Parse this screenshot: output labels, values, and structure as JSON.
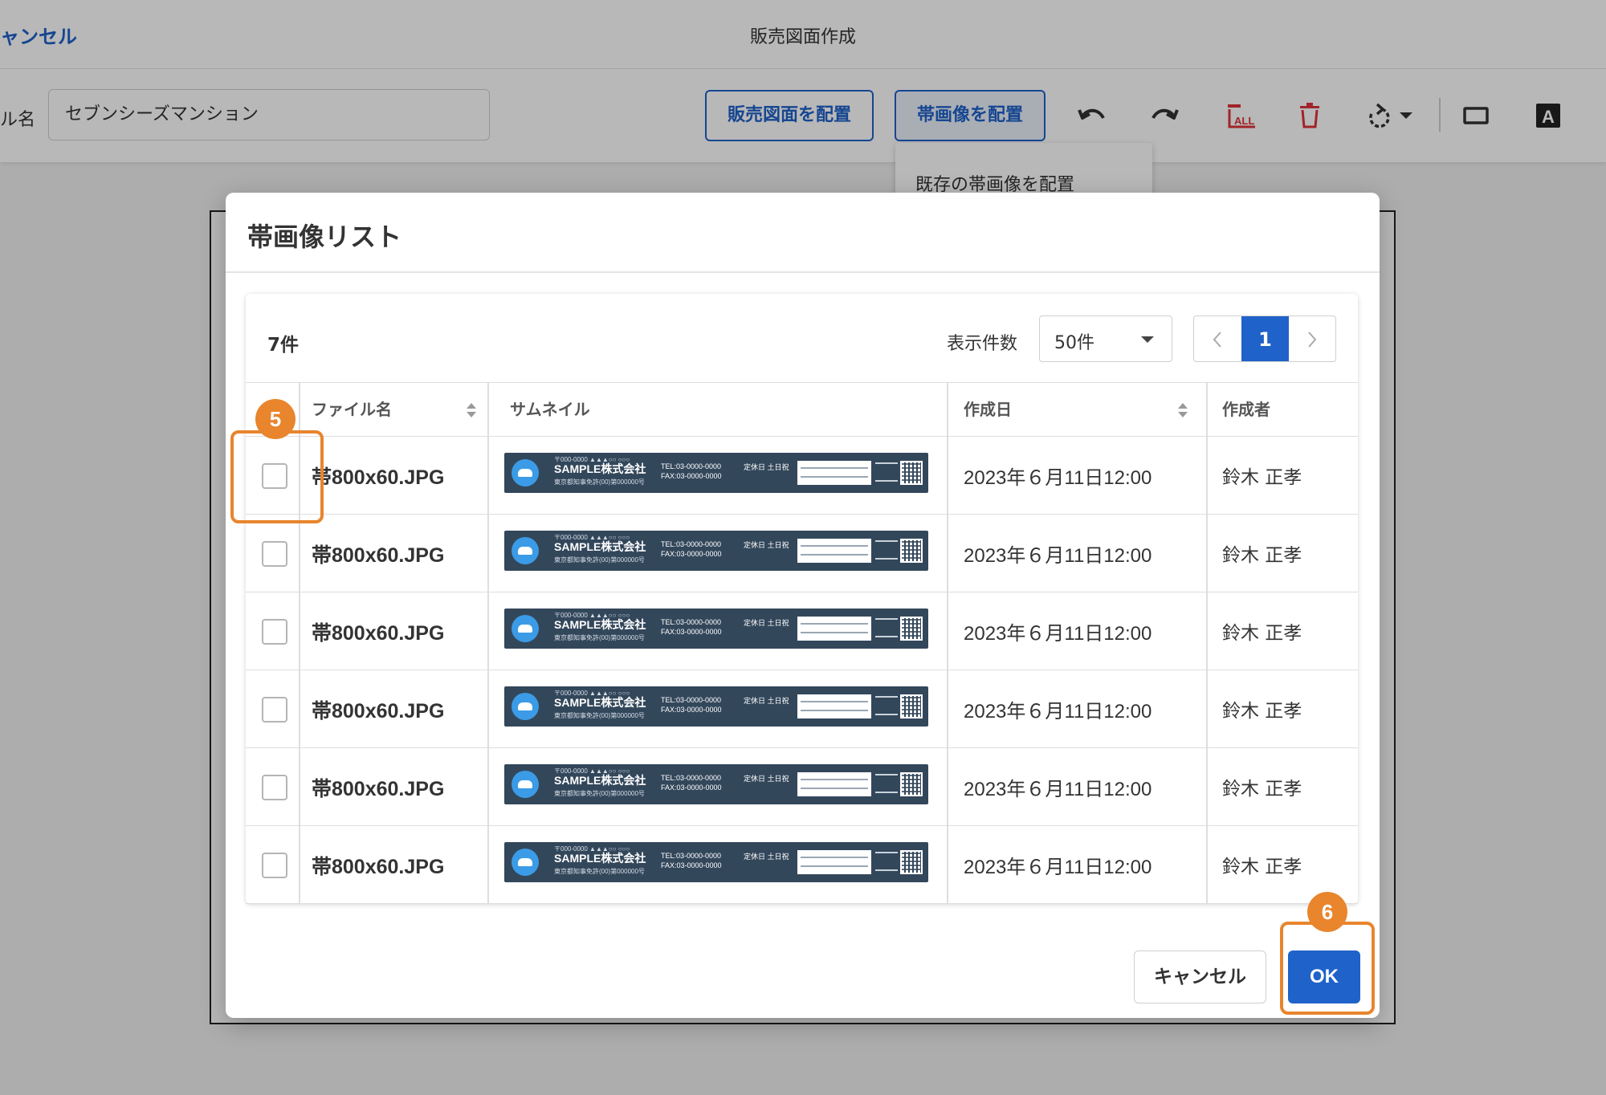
{
  "app": {
    "cancel_link": "ャンセル",
    "title": "販売図面作成",
    "name_label": "ル名",
    "name_value": "セブンシーズマンション",
    "place_sales_drawing": "販売図面を配置",
    "place_band_image": "帯画像を配置",
    "dropdown_item": "既存の帯画像を配置",
    "icons": [
      "undo-icon",
      "redo-icon",
      "delete-all-icon",
      "trash-icon",
      "rotate-icon",
      "rectangle-icon",
      "text-icon"
    ],
    "delete_all_text": "ALL",
    "text_tool_letter": "A"
  },
  "modal": {
    "title": "帯画像リスト",
    "count": "7件",
    "per_page_label": "表示件数",
    "per_page_value": "50件",
    "current_page": "1",
    "columns": {
      "filename": "ファイル名",
      "thumbnail": "サムネイル",
      "created": "作成日",
      "author": "作成者"
    },
    "thumbnail_sample": {
      "company": "SAMPLE株式会社",
      "tel": "TEL:03-0000-0000",
      "fax": "FAX:03-0000-0000",
      "holiday": "定休日 土日祝"
    },
    "rows": [
      {
        "filename": "帯800x60.JPG",
        "created": "2023年６月11日12:00",
        "author": "鈴木 正孝"
      },
      {
        "filename": "帯800x60.JPG",
        "created": "2023年６月11日12:00",
        "author": "鈴木 正孝"
      },
      {
        "filename": "帯800x60.JPG",
        "created": "2023年６月11日12:00",
        "author": "鈴木 正孝"
      },
      {
        "filename": "帯800x60.JPG",
        "created": "2023年６月11日12:00",
        "author": "鈴木 正孝"
      },
      {
        "filename": "帯800x60.JPG",
        "created": "2023年６月11日12:00",
        "author": "鈴木 正孝"
      },
      {
        "filename": "帯800x60.JPG",
        "created": "2023年６月11日12:00",
        "author": "鈴木 正孝"
      }
    ],
    "cancel_button": "キャンセル",
    "ok_button": "OK"
  },
  "annotations": {
    "step5": "5",
    "step6": "6"
  },
  "colors": {
    "primary": "#1f62c9",
    "annotation": "#e8852d",
    "danger": "#e0323a",
    "thumbnail_bg": "#33475b"
  }
}
